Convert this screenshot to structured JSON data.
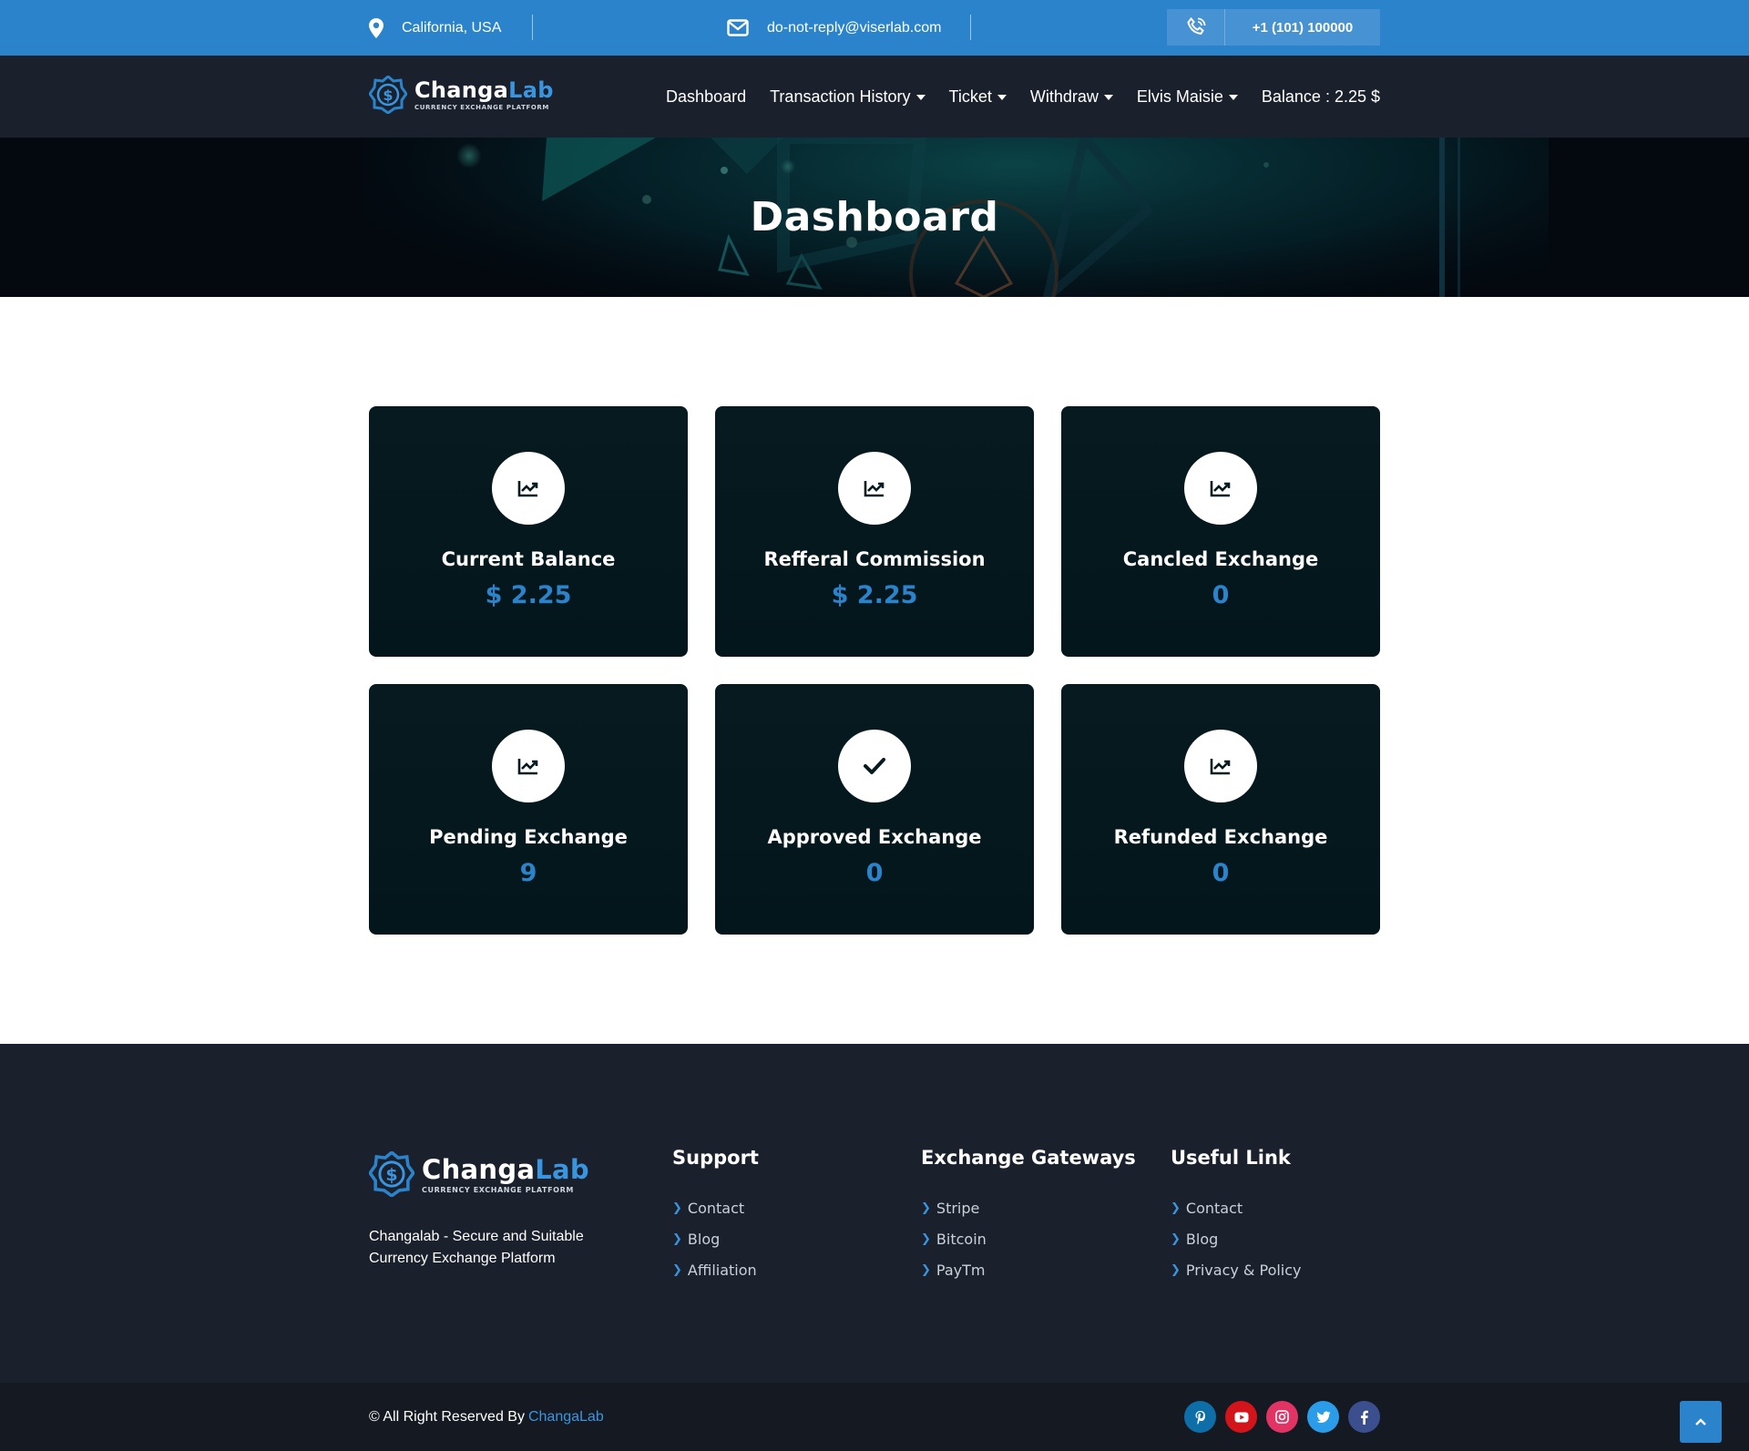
{
  "topbar": {
    "location": "California, USA",
    "email": "do-not-reply@viserlab.com",
    "phone": "+1 (101) 100000"
  },
  "brand": {
    "name_part1": "Changa",
    "name_part2": "Lab",
    "tagline": "CURRENCY EXCHANGE PLATFORM"
  },
  "nav": {
    "dashboard": "Dashboard",
    "transaction_history": "Transaction History",
    "ticket": "Ticket",
    "withdraw": "Withdraw",
    "user": "Elvis Maisie",
    "balance": "Balance : 2.25 $"
  },
  "hero": {
    "title": "Dashboard"
  },
  "cards": [
    {
      "title": "Current Balance",
      "value": "$ 2.25",
      "icon": "chart-line-icon"
    },
    {
      "title": "Refferal Commission",
      "value": "$ 2.25",
      "icon": "chart-line-icon"
    },
    {
      "title": "Cancled Exchange",
      "value": "0",
      "icon": "chart-line-icon"
    },
    {
      "title": "Pending Exchange",
      "value": "9",
      "icon": "chart-line-icon"
    },
    {
      "title": "Approved Exchange",
      "value": "0",
      "icon": "check-icon"
    },
    {
      "title": "Refunded Exchange",
      "value": "0",
      "icon": "chart-line-icon"
    }
  ],
  "footer": {
    "description": "Changalab - Secure and Suitable Currency Exchange Platform",
    "support": {
      "title": "Support",
      "links": [
        "Contact",
        "Blog",
        "Affiliation"
      ]
    },
    "gateways": {
      "title": "Exchange Gateways",
      "links": [
        "Stripe",
        "Bitcoin",
        "PayTm"
      ]
    },
    "useful": {
      "title": "Useful Link",
      "links": [
        "Contact",
        "Blog",
        "Privacy & Policy"
      ]
    },
    "copyright_prefix": "© All Right Reserved By",
    "copyright_brand": "ChangaLab",
    "socials": [
      {
        "name": "pinterest-icon",
        "color": "#0e6ea8"
      },
      {
        "name": "youtube-icon",
        "color": "#d4141b"
      },
      {
        "name": "instagram-icon",
        "color": "#e23464"
      },
      {
        "name": "twitter-icon",
        "color": "#2b9de8"
      },
      {
        "name": "facebook-icon",
        "color": "#3b4f8f"
      }
    ]
  },
  "colors": {
    "accent": "#2b84cb",
    "nav_bg": "#1b212c",
    "card_bg": "#061a20"
  }
}
